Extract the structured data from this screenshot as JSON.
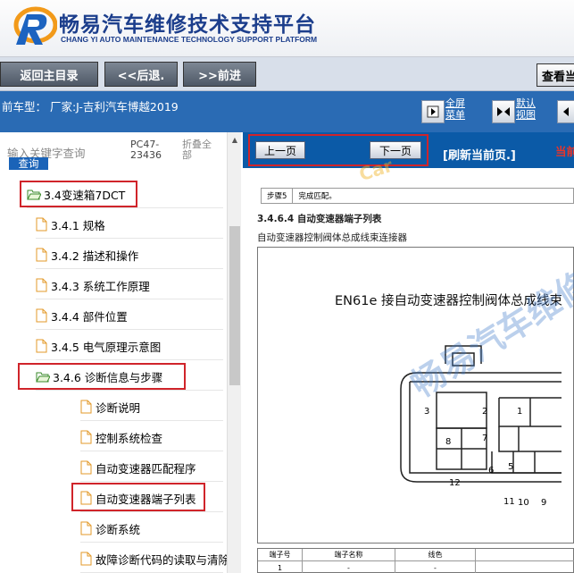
{
  "header": {
    "title_cn": "畅易汽车维修技术支持平台",
    "title_en": "CHANG YI AUTO MAINTENANCE TECHNOLOGY SUPPORT PLATFORM",
    "brand_color": "#1c3e8c"
  },
  "nav": {
    "home": "返回主目录",
    "back": "<<后退.",
    "forward": ">>前进",
    "view_current": "查看当"
  },
  "infobar": {
    "vehicle": "前车型：  厂家:J-吉利汽车博越2019",
    "fullscreen": [
      "全屏",
      "菜单"
    ],
    "default_view": [
      "默认",
      "视图"
    ]
  },
  "left": {
    "search_hint": "输入关键字查询",
    "search_btn": "查询",
    "code": "PC47-23436",
    "collapse": "折叠全部",
    "tree": [
      {
        "label": "3.4变速箱7DCT",
        "type": "folder"
      },
      {
        "label": "3.4.1 规格",
        "type": "file"
      },
      {
        "label": "3.4.2 描述和操作",
        "type": "file"
      },
      {
        "label": "3.4.3 系统工作原理",
        "type": "file"
      },
      {
        "label": "3.4.4 部件位置",
        "type": "file"
      },
      {
        "label": "3.4.5 电气原理示意图",
        "type": "file"
      },
      {
        "label": "3.4.6 诊断信息与步骤",
        "type": "folder"
      },
      {
        "label": "诊断说明",
        "type": "file"
      },
      {
        "label": "控制系统检查",
        "type": "file"
      },
      {
        "label": "自动变速器匹配程序",
        "type": "file"
      },
      {
        "label": "自动变速器端子列表",
        "type": "file"
      },
      {
        "label": "诊断系统",
        "type": "file"
      },
      {
        "label": "故障诊断代码的读取与清除",
        "type": "file"
      }
    ]
  },
  "right": {
    "prev": "上一页",
    "next": "下一页",
    "refresh": "[刷新当前页.]",
    "current": "当前",
    "doc_step": [
      "步骤5",
      "完成匹配。"
    ],
    "doc_heading": "3.4.6.4 自动变速器端子列表",
    "doc_sub": "自动变速器控制阀体总成线束连接器",
    "drawing_title": "EN61e 接自动变速器控制阀体总成线束",
    "pins": [
      "3",
      "2",
      "1",
      "8",
      "7",
      "6",
      "5",
      "12",
      "11",
      "10",
      "9"
    ],
    "pin_table_headers": [
      "端子号",
      "端子名称",
      "线色"
    ],
    "pin_table_row": [
      "1",
      "-",
      "-"
    ],
    "watermark": "畅易汽车维修",
    "watermark_small": "Car"
  },
  "colors": {
    "infobar": "#2a6bb4",
    "content_bar": "#0b5aa7",
    "highlight": "#d0242a",
    "current_red": "#e8352a"
  }
}
